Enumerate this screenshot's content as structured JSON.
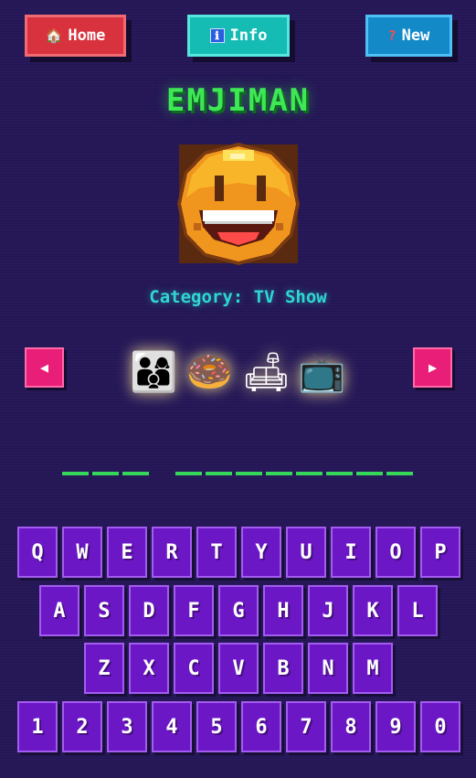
{
  "nav": {
    "home": {
      "icon": "🏠",
      "label": "Home"
    },
    "info": {
      "icon": "ℹ",
      "label": "Info"
    },
    "new": {
      "icon": "?",
      "label": "New"
    }
  },
  "game": {
    "title": "EMJIMAN",
    "category": "Category: TV Show",
    "clues": [
      "👨‍👩‍👦",
      "🍩",
      "🛋",
      "📺"
    ],
    "clue_icons": [
      "family-icon",
      "donut-icon",
      "couch-icon",
      "television-icon"
    ],
    "answer_word_lengths": [
      3,
      8
    ],
    "prev_arrow": "◀",
    "next_arrow": "▶"
  },
  "keyboard": {
    "row1": [
      "Q",
      "W",
      "E",
      "R",
      "T",
      "Y",
      "U",
      "I",
      "O",
      "P"
    ],
    "row2": [
      "A",
      "S",
      "D",
      "F",
      "G",
      "H",
      "J",
      "K",
      "L"
    ],
    "row3": [
      "Z",
      "X",
      "C",
      "V",
      "B",
      "N",
      "M"
    ],
    "row4": [
      "1",
      "2",
      "3",
      "4",
      "5",
      "6",
      "7",
      "8",
      "9",
      "0"
    ]
  },
  "colors": {
    "background": "#27195a",
    "title": "#3ee855",
    "category": "#2fd7d2",
    "key": "#6c17c6",
    "arrow": "#e91e78",
    "slot": "#36d65a"
  }
}
